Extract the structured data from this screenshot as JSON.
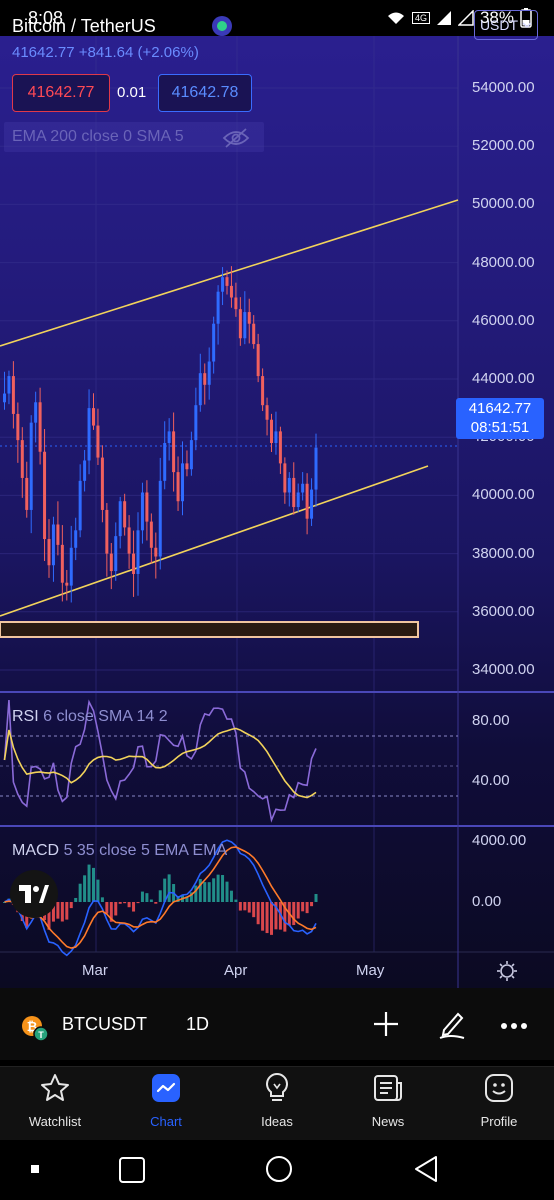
{
  "status": {
    "time": "8:08",
    "battery": "38%",
    "network": "4G"
  },
  "header": {
    "pair": "Bitcoin / TetherUS",
    "quote": "41642.77  +841.64 (+2.06%)",
    "bid": "41642.77",
    "spread": "0.01",
    "ask": "41642.78",
    "indicator": "EMA 200 close 0 SMA 5",
    "currency": "USDT"
  },
  "price_axis": [
    "54000.00",
    "52000.00",
    "50000.00",
    "48000.00",
    "46000.00",
    "44000.00",
    "42000.00",
    "40000.00",
    "38000.00",
    "36000.00",
    "34000.00"
  ],
  "last_price": {
    "price": "41642.77",
    "countdown": "08:51:51"
  },
  "rsi": {
    "name": "RSI",
    "params": "6 close SMA 14 2",
    "axis": [
      "80.00",
      "40.00"
    ]
  },
  "macd": {
    "name": "MACD",
    "params": "5 35 close 5 EMA EMA",
    "axis": [
      "4000.00",
      "0.00"
    ]
  },
  "time_axis": [
    "Mar",
    "Apr",
    "May"
  ],
  "toolbar": {
    "symbol": "BTCUSDT",
    "interval": "1D"
  },
  "tabs": [
    {
      "label": "Watchlist"
    },
    {
      "label": "Chart"
    },
    {
      "label": "Ideas"
    },
    {
      "label": "News"
    },
    {
      "label": "Profile"
    }
  ],
  "colors": {
    "up": "#2f6bff",
    "down": "#f0605e",
    "accent": "#2962ff",
    "trendline": "#f2d35b"
  },
  "chart_data": {
    "type": "candlestick",
    "symbol": "BTCUSDT",
    "interval": "1D",
    "y_range": [
      34000,
      54000
    ],
    "x_ticks": [
      "Mar",
      "Apr",
      "May"
    ],
    "closes": [
      43500,
      44100,
      42800,
      41900,
      40600,
      39500,
      42500,
      43200,
      41500,
      38500,
      37600,
      39000,
      38300,
      37000,
      36900,
      38200,
      38800,
      40500,
      41200,
      43000,
      42400,
      41300,
      39500,
      38000,
      37400,
      38600,
      39800,
      38900,
      38000,
      37300,
      38800,
      40100,
      39100,
      38200,
      37900,
      40500,
      41800,
      42200,
      40800,
      39800,
      41100,
      40900,
      41900,
      43100,
      44200,
      43800,
      44600,
      45900,
      47000,
      47500,
      47200,
      46800,
      46400,
      45400,
      46300,
      45900,
      45200,
      44100,
      43100,
      42600,
      41800,
      42200,
      41100,
      40100,
      40600,
      39600,
      40100,
      40400,
      39200,
      40200,
      41643
    ]
  }
}
